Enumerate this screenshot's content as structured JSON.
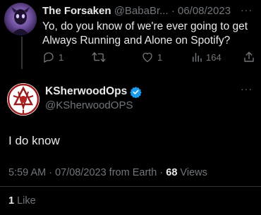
{
  "parent_tweet": {
    "display_name": "The Forsaken",
    "handle_truncated": "@BabaBr...",
    "date": "· 06/08/2023",
    "more_label": "···",
    "text": "Yo, do you know of we're ever going to get Always Running and Alone on Spotify?",
    "replies": "1",
    "retweets": "",
    "likes": "1",
    "views": "164"
  },
  "main_tweet": {
    "display_name": "KSherwoodOps",
    "handle": "@KSherwoodOPS",
    "more_label": "···",
    "text": "I do know",
    "timestamp": "5:59 AM · 07/08/2023 from Earth · ",
    "view_count": "68",
    "views_label": " Views",
    "like_count": "1",
    "like_label": " Like"
  },
  "colors": {
    "background": "#000000",
    "text": "#e7e9ea",
    "muted": "#71767b",
    "verified": "#1d9bf0",
    "divider": "#2f3336"
  },
  "icons": [
    "reply-icon",
    "retweet-icon",
    "like-icon",
    "views-icon",
    "share-icon",
    "verified-badge-icon",
    "more-icon"
  ]
}
